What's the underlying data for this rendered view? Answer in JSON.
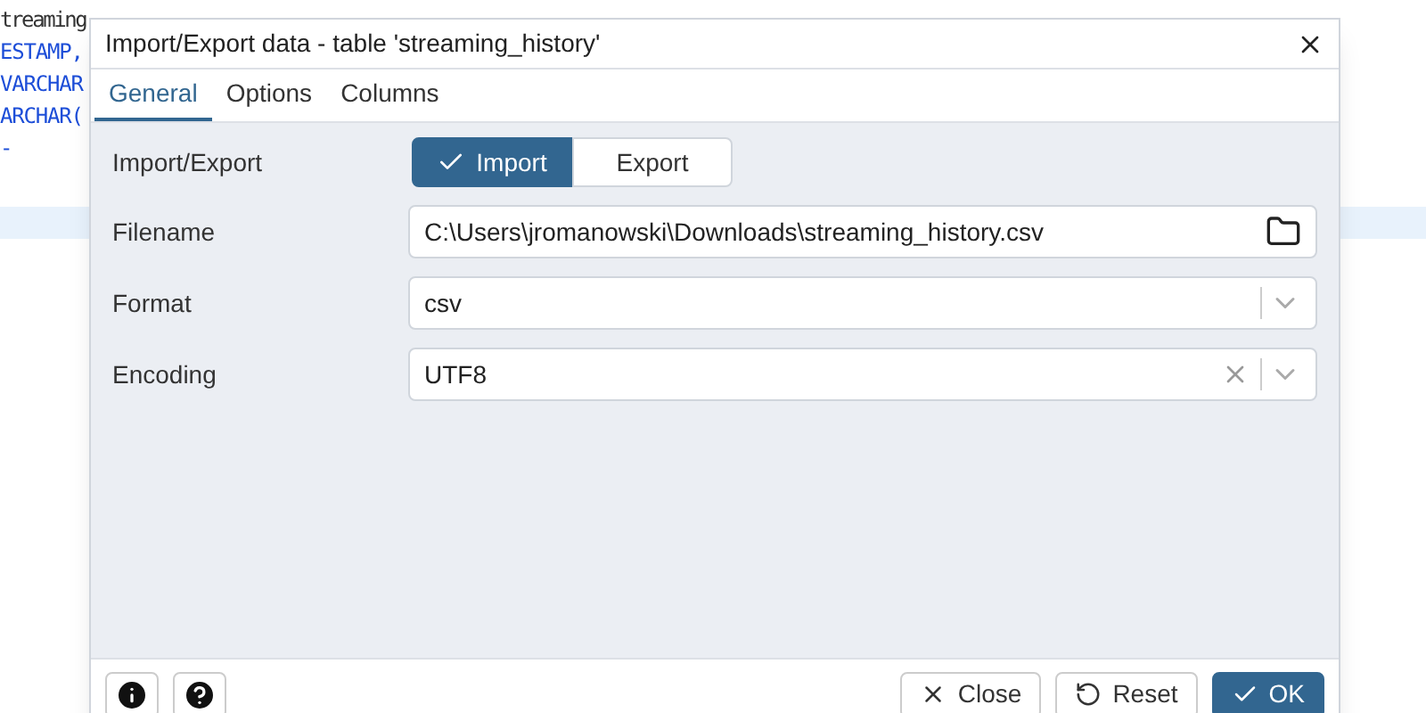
{
  "editor": {
    "lines": [
      "treaming",
      "ESTAMP,",
      "VARCHAR",
      "ARCHAR(",
      "-"
    ]
  },
  "dialog": {
    "title": "Import/Export data - table 'streaming_history'",
    "tabs": [
      {
        "label": "General",
        "selected": true
      },
      {
        "label": "Options",
        "selected": false
      },
      {
        "label": "Columns",
        "selected": false
      }
    ],
    "fields": [
      {
        "kind": "toggle",
        "label": "Import/Export",
        "options": [
          {
            "label": "Import",
            "selected": true
          },
          {
            "label": "Export",
            "selected": false
          }
        ]
      },
      {
        "kind": "file",
        "label": "Filename",
        "value": "C:\\Users\\jromanowski\\Downloads\\streaming_history.csv"
      },
      {
        "kind": "select",
        "label": "Format",
        "value": "csv",
        "clearable": false
      },
      {
        "kind": "select",
        "label": "Encoding",
        "value": "UTF8",
        "clearable": true
      }
    ],
    "buttons": [
      {
        "kind": "close",
        "label": "Close"
      },
      {
        "kind": "reset",
        "label": "Reset"
      },
      {
        "kind": "ok",
        "label": "OK"
      }
    ]
  }
}
